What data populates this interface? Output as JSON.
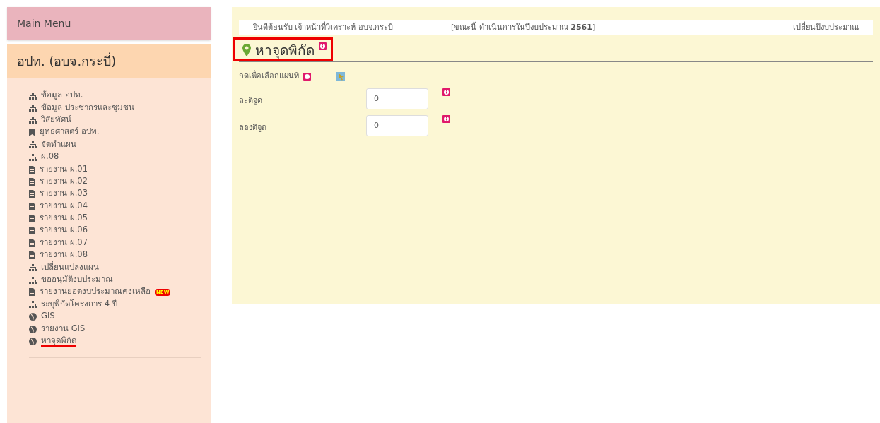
{
  "sidebar": {
    "title": "Main Menu",
    "section_title": "อปท. (อบจ.กระบี่)",
    "items": [
      {
        "kind": "tree",
        "label": "ข้อมูล อปท.",
        "selected": false
      },
      {
        "kind": "tree",
        "label": "ข้อมูล ประชากรและชุมชน",
        "selected": false
      },
      {
        "kind": "tree",
        "label": "วิสัยทัศน์",
        "selected": false
      },
      {
        "kind": "bookmark",
        "label": "ยุทธศาสตร์ อปท.",
        "selected": false
      },
      {
        "kind": "tree",
        "label": "จัดทำแผน",
        "selected": false
      },
      {
        "kind": "tree",
        "label": "ผ.08",
        "selected": false
      },
      {
        "kind": "file",
        "label": "รายงาน ผ.01",
        "selected": false
      },
      {
        "kind": "file",
        "label": "รายงาน ผ.02",
        "selected": false
      },
      {
        "kind": "file",
        "label": "รายงาน ผ.03",
        "selected": false
      },
      {
        "kind": "file",
        "label": "รายงาน ผ.04",
        "selected": false
      },
      {
        "kind": "file",
        "label": "รายงาน ผ.05",
        "selected": false
      },
      {
        "kind": "file",
        "label": "รายงาน ผ.06",
        "selected": false
      },
      {
        "kind": "file",
        "label": "รายงาน ผ.07",
        "selected": false
      },
      {
        "kind": "file",
        "label": "รายงาน ผ.08",
        "selected": false
      },
      {
        "kind": "tree",
        "label": "เปลี่ยนแปลงแผน",
        "selected": false
      },
      {
        "kind": "tree",
        "label": "ขออนุมัติงบประมาณ",
        "selected": false
      },
      {
        "kind": "file",
        "label": "รายงานยอดงบประมาณคงเหลือ",
        "badge": "NEW",
        "selected": false
      },
      {
        "kind": "tree",
        "label": "ระบุพิกัดโครงการ 4 ปี",
        "selected": false
      },
      {
        "kind": "globe",
        "label": "GIS",
        "selected": false
      },
      {
        "kind": "globe",
        "label": "รายงาน GIS",
        "selected": false
      },
      {
        "kind": "globe",
        "label": "หาจุดพิกัด",
        "selected": true
      }
    ]
  },
  "top_bar": {
    "welcome": "ยินดีต้อนรับ เจ้าหน้าที่วิเคราะห์ อบจ.กระบี่",
    "fiscal_year": "[ขณะนี้ ดำเนินการในปีงบประมาณ **2561**]",
    "change_year_link": "เปลี่ยนปีงบประมาณ"
  },
  "page": {
    "title": "หาจุดพิกัด",
    "highlighted": true,
    "map_label": "กดเพื่อเลือกแผนที่",
    "fields": [
      {
        "label": "ละติจูด",
        "value": "0"
      },
      {
        "label": "ลองติจูด",
        "value": "0"
      }
    ]
  }
}
